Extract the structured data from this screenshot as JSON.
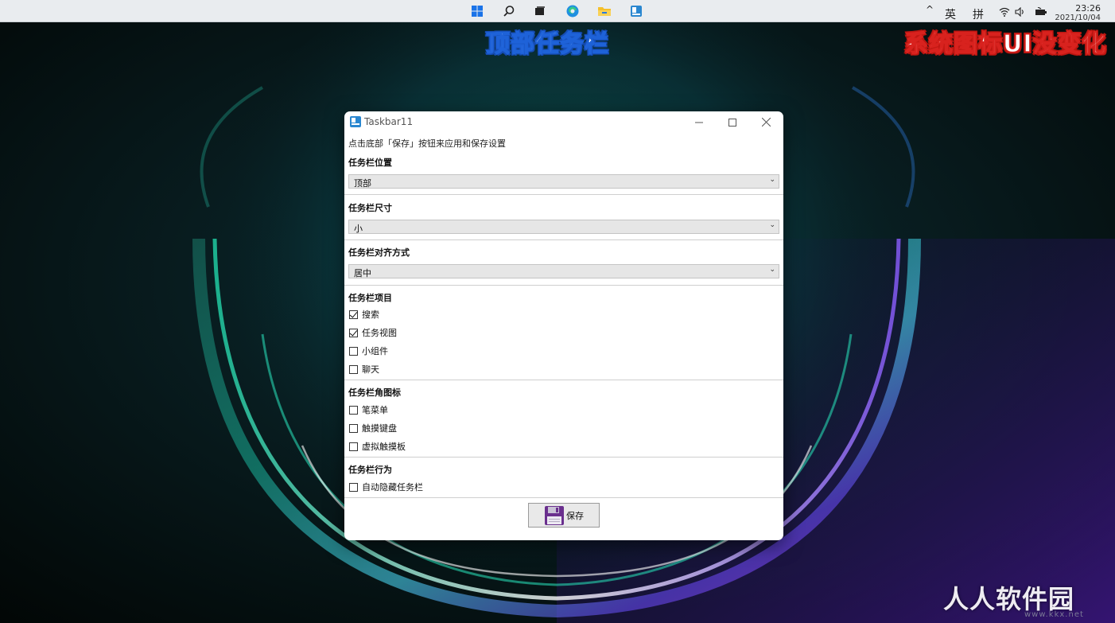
{
  "captions": {
    "left": "顶部任务栏",
    "right": "系统图标UI没变化"
  },
  "watermark": {
    "main": "人人软件园",
    "sub": "www.kkx.net"
  },
  "taskbar": {
    "icons": [
      "start-icon",
      "search-icon",
      "task-view-icon",
      "edge-icon",
      "file-explorer-icon",
      "taskbar11-app-icon"
    ],
    "tray": {
      "chevron": "^",
      "ime_lang": "英",
      "ime_mode": "拼",
      "time": "23:26",
      "date": "2021/10/04"
    }
  },
  "window": {
    "title": "Taskbar11",
    "hint": "点击底部「保存」按钮来应用和保存设置",
    "position": {
      "label": "任务栏位置",
      "value": "顶部"
    },
    "size": {
      "label": "任务栏尺寸",
      "value": "小"
    },
    "alignment": {
      "label": "任务栏对齐方式",
      "value": "居中"
    },
    "items": {
      "label": "任务栏项目",
      "options": [
        {
          "label": "搜索",
          "checked": true
        },
        {
          "label": "任务视图",
          "checked": true
        },
        {
          "label": "小组件",
          "checked": false
        },
        {
          "label": "聊天",
          "checked": false
        }
      ]
    },
    "corner_icons": {
      "label": "任务栏角图标",
      "options": [
        {
          "label": "笔菜单",
          "checked": false
        },
        {
          "label": "触摸键盘",
          "checked": false
        },
        {
          "label": "虚拟触摸板",
          "checked": false
        }
      ]
    },
    "behavior": {
      "label": "任务栏行为",
      "options": [
        {
          "label": "自动隐藏任务栏",
          "checked": false
        }
      ]
    },
    "save_label": "保存"
  },
  "colors": {
    "caption_left_stroke": "#1e62d8",
    "caption_right_stroke": "#d8221e",
    "combo_bg": "#e6e6e6"
  }
}
